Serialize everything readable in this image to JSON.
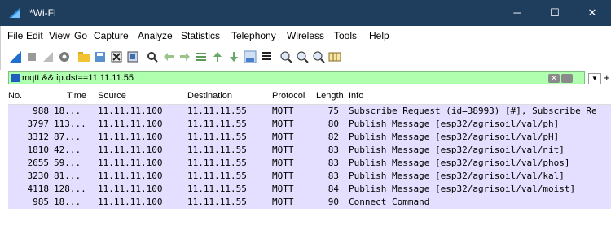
{
  "window": {
    "title": "*Wi-Fi",
    "controls": {
      "minimize": "─",
      "maximize": "☐",
      "close": "✕"
    }
  },
  "menu": [
    "File",
    "Edit",
    "View",
    "Go",
    "Capture",
    "Analyze",
    "Statistics",
    "Telephony",
    "Wireless",
    "Tools",
    "Help"
  ],
  "toolbar": {
    "icons": [
      "shark-start-icon",
      "stop-icon",
      "restart-icon",
      "options-icon",
      "open-folder-icon",
      "save-icon",
      "close-file-icon",
      "reload-icon",
      "find-icon",
      "back-icon",
      "forward-icon",
      "go-to-packet-icon",
      "first-packet-icon",
      "last-packet-icon",
      "autoscroll-icon",
      "colorize-icon",
      "zoom-in-icon",
      "zoom-out-icon",
      "zoom-normal-icon",
      "resize-columns-icon"
    ]
  },
  "filter": {
    "value": "mqtt && ip.dst==11.11.11.55",
    "clear_symbol": "✕",
    "add_symbol": "+"
  },
  "columns": {
    "no": "No.",
    "time": "Time",
    "source": "Source",
    "destination": "Destination",
    "protocol": "Protocol",
    "length": "Length",
    "info": "Info"
  },
  "packets": [
    {
      "no": "988",
      "time": "18...",
      "source": "11.11.11.100",
      "destination": "11.11.11.55",
      "protocol": "MQTT",
      "length": "75",
      "info": "Subscribe Request (id=38993) [#], Subscribe Re"
    },
    {
      "no": "3797",
      "time": "113...",
      "source": "11.11.11.100",
      "destination": "11.11.11.55",
      "protocol": "MQTT",
      "length": "80",
      "info": "Publish Message [esp32/agrisoil/val/ph]"
    },
    {
      "no": "3312",
      "time": "87...",
      "source": "11.11.11.100",
      "destination": "11.11.11.55",
      "protocol": "MQTT",
      "length": "82",
      "info": "Publish Message [esp32/agrisoil/val/pH]"
    },
    {
      "no": "1810",
      "time": "42...",
      "source": "11.11.11.100",
      "destination": "11.11.11.55",
      "protocol": "MQTT",
      "length": "83",
      "info": "Publish Message [esp32/agrisoil/val/nit]"
    },
    {
      "no": "2655",
      "time": "59...",
      "source": "11.11.11.100",
      "destination": "11.11.11.55",
      "protocol": "MQTT",
      "length": "83",
      "info": "Publish Message [esp32/agrisoil/val/phos]"
    },
    {
      "no": "3230",
      "time": "81...",
      "source": "11.11.11.100",
      "destination": "11.11.11.55",
      "protocol": "MQTT",
      "length": "83",
      "info": "Publish Message [esp32/agrisoil/val/kal]"
    },
    {
      "no": "4118",
      "time": "128...",
      "source": "11.11.11.100",
      "destination": "11.11.11.55",
      "protocol": "MQTT",
      "length": "84",
      "info": "Publish Message [esp32/agrisoil/val/moist]"
    },
    {
      "no": "985",
      "time": "18...",
      "source": "11.11.11.100",
      "destination": "11.11.11.55",
      "protocol": "MQTT",
      "length": "90",
      "info": "Connect Command"
    }
  ],
  "colors": {
    "titlebar": "#1f3d5c",
    "filter_valid": "#afffaf",
    "mqtt_row": "#e4dfff"
  }
}
